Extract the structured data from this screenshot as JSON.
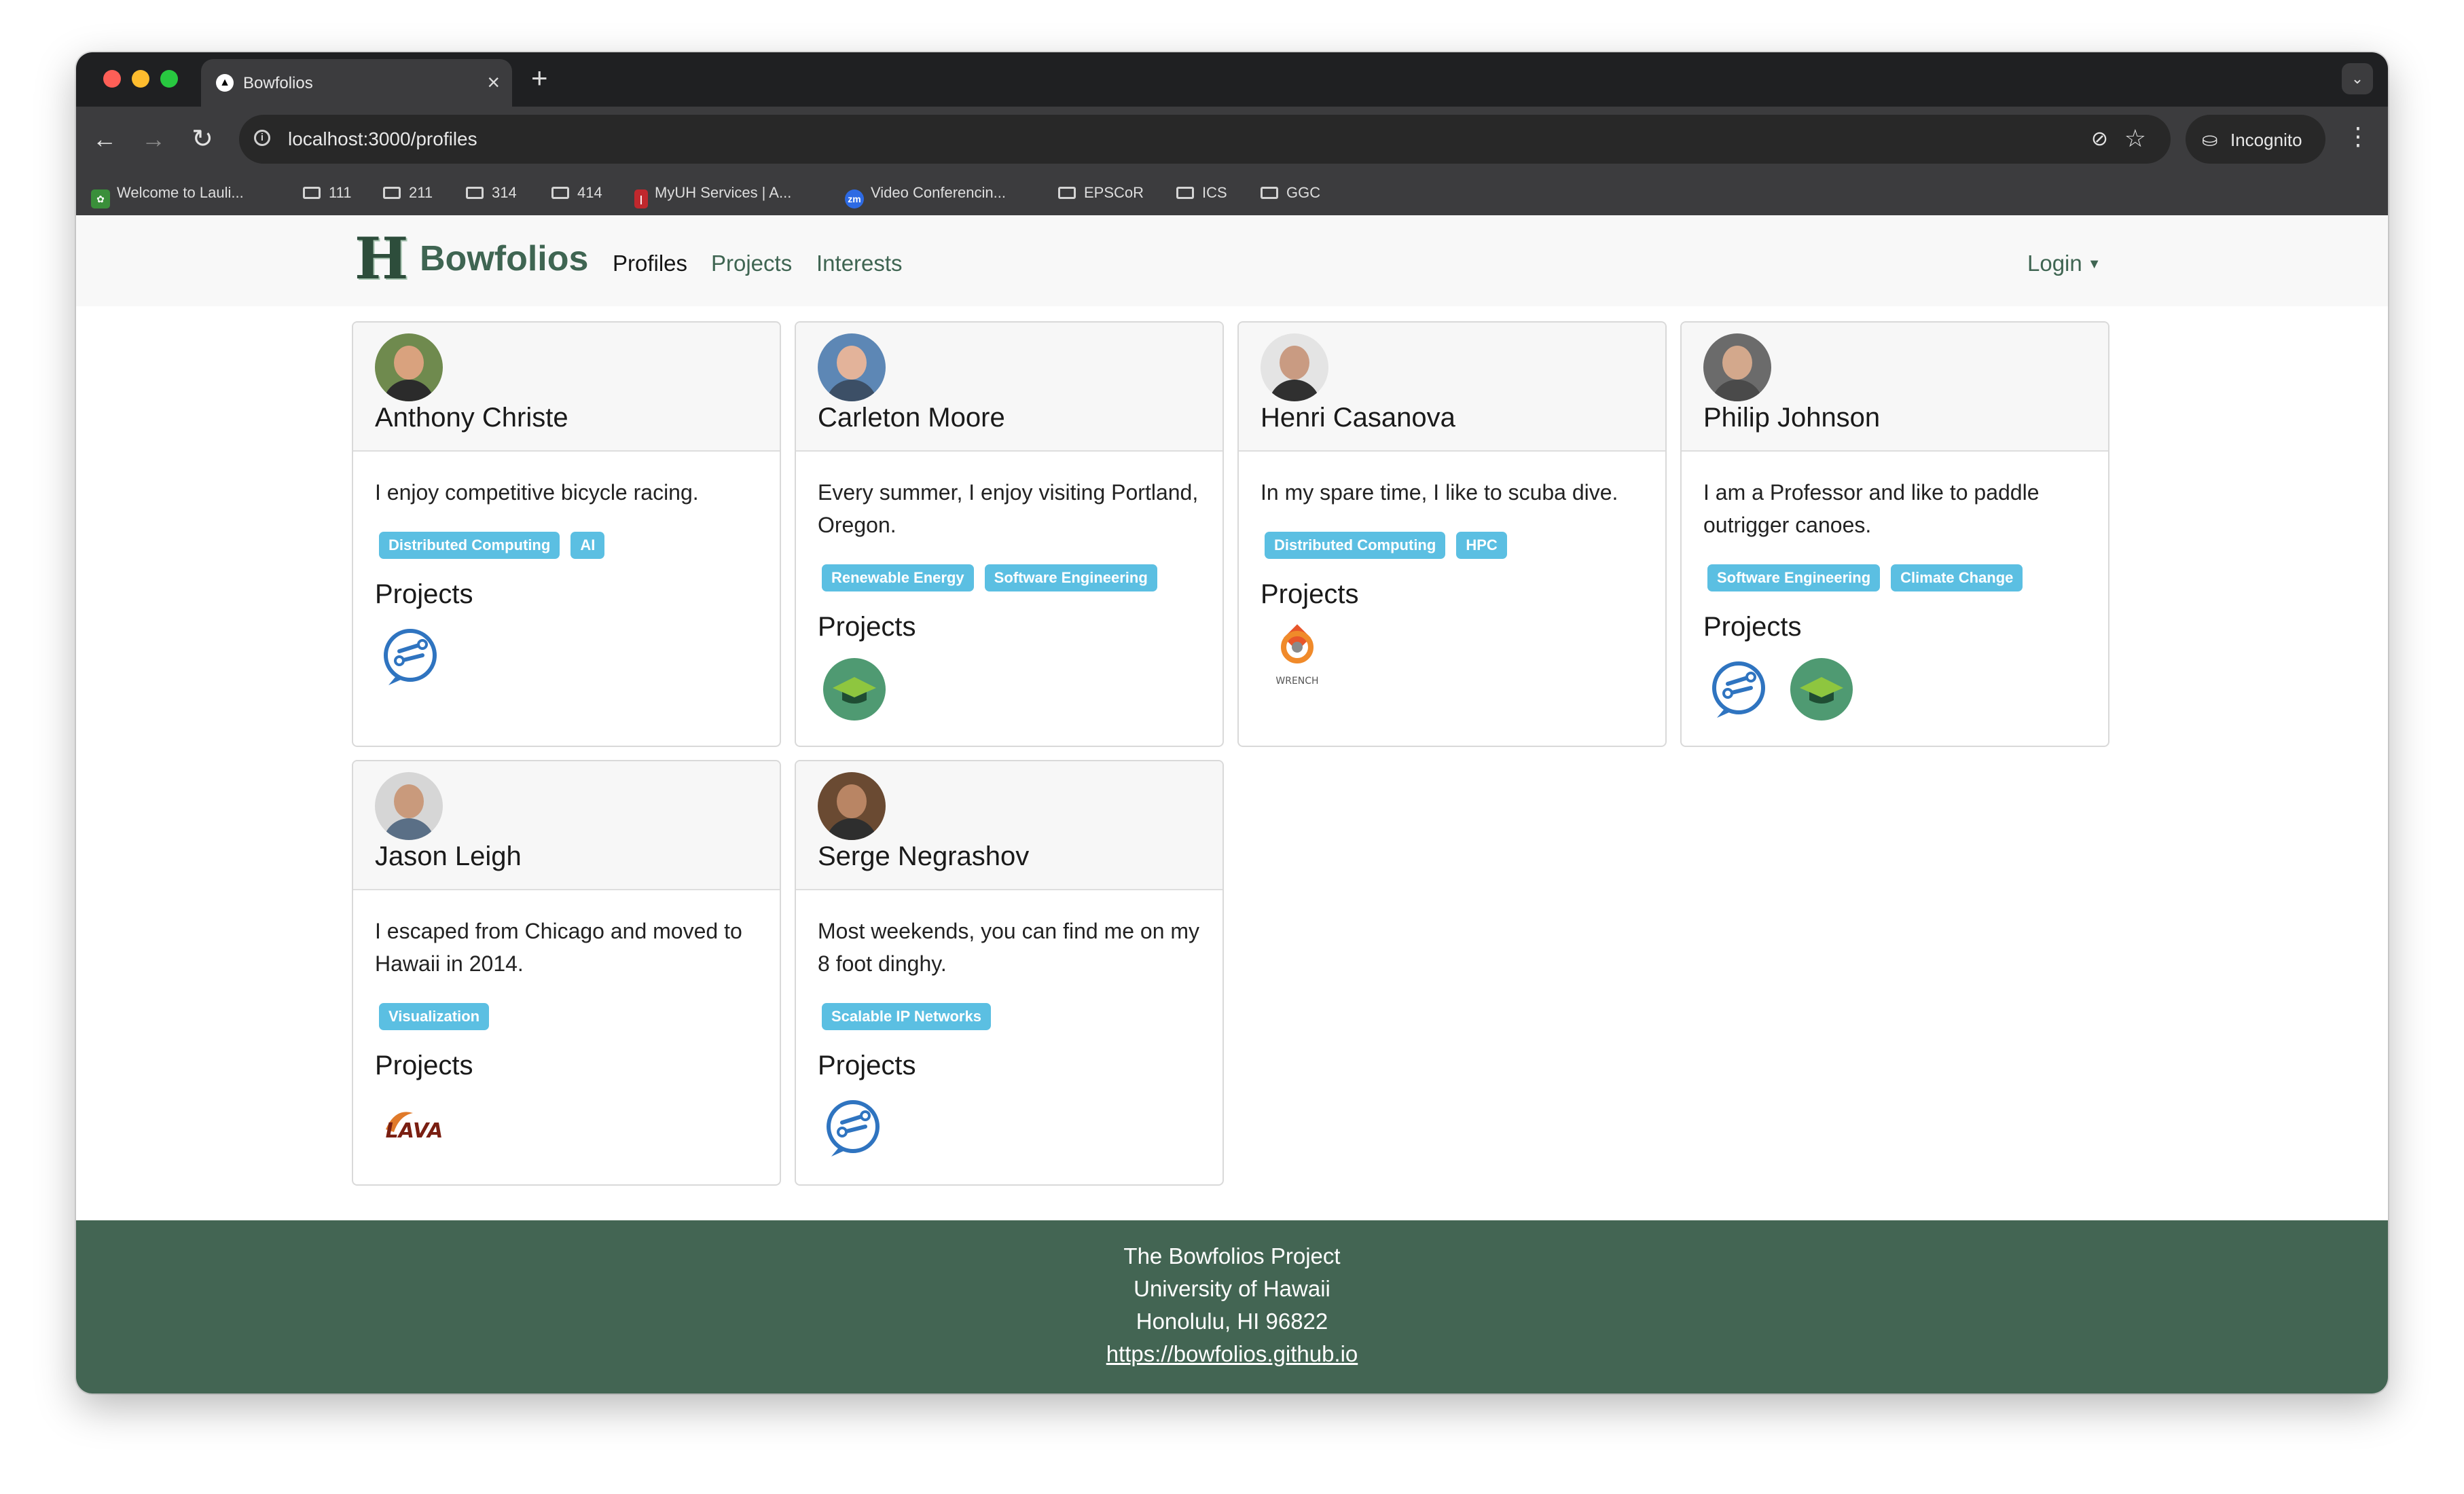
{
  "browser": {
    "tab_title": "Bowfolios",
    "tab_favicon": "▲",
    "tab_close": "×",
    "new_tab": "+",
    "url": "localhost:3000/profiles",
    "incognito_label": "Incognito",
    "bookmarks": [
      {
        "label": "Welcome to Lauli...",
        "icon": "leaf-icon"
      },
      {
        "label": "111",
        "icon": "folder-icon"
      },
      {
        "label": "211",
        "icon": "folder-icon"
      },
      {
        "label": "314",
        "icon": "folder-icon"
      },
      {
        "label": "414",
        "icon": "folder-icon"
      },
      {
        "label": "MyUH Services | A...",
        "icon": "myuh-icon"
      },
      {
        "label": "Video Conferencin...",
        "icon": "zoom-icon"
      },
      {
        "label": "EPSCoR",
        "icon": "folder-icon"
      },
      {
        "label": "ICS",
        "icon": "folder-icon"
      },
      {
        "label": "GGC",
        "icon": "folder-icon"
      }
    ]
  },
  "navbar": {
    "brand": "Bowfolios",
    "links": [
      "Profiles",
      "Projects",
      "Interests"
    ],
    "active_link": "Profiles",
    "login": "Login"
  },
  "profiles": [
    {
      "name": "Anthony Christe",
      "description": "I enjoy competitive bicycle racing.",
      "interests": [
        "Distributed Computing",
        "AI"
      ],
      "projects_label": "Projects",
      "projects": [
        "radgrad-icon"
      ]
    },
    {
      "name": "Carleton Moore",
      "description": "Every summer, I enjoy visiting Portland, Oregon.",
      "interests": [
        "Renewable Energy",
        "Software Engineering"
      ],
      "projects_label": "Projects",
      "projects": [
        "graduation-cap-icon"
      ]
    },
    {
      "name": "Henri Casanova",
      "description": "In my spare time, I like to scuba dive.",
      "interests": [
        "Distributed Computing",
        "HPC"
      ],
      "projects_label": "Projects",
      "projects": [
        "wrench-icon"
      ]
    },
    {
      "name": "Philip Johnson",
      "description": "I am a Professor and like to paddle outrigger canoes.",
      "interests": [
        "Software Engineering",
        "Climate Change"
      ],
      "projects_label": "Projects",
      "projects": [
        "radgrad-icon",
        "graduation-cap-icon"
      ]
    },
    {
      "name": "Jason Leigh",
      "description": "I escaped from Chicago and moved to Hawaii in 2014.",
      "interests": [
        "Visualization"
      ],
      "projects_label": "Projects",
      "projects": [
        "lava-icon"
      ]
    },
    {
      "name": "Serge Negrashov",
      "description": "Most weekends, you can find me on my 8 foot dinghy.",
      "interests": [
        "Scalable IP Networks"
      ],
      "projects_label": "Projects",
      "projects": [
        "radgrad-icon"
      ]
    }
  ],
  "project_icon_text": {
    "wrench": "WRENCH",
    "lava": "LAVA"
  },
  "footer": {
    "line1": "The Bowfolios Project",
    "line2": "University of Hawaii",
    "line3": "Honolulu, HI 96822",
    "link": "https://bowfolios.github.io"
  },
  "colors": {
    "brand_green": "#3f6552",
    "footer_green": "#436553",
    "badge_blue": "#5bbfe2"
  }
}
